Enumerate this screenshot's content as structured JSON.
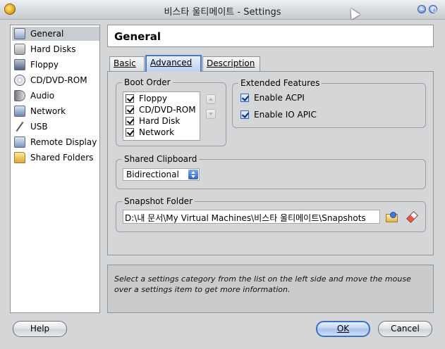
{
  "window": {
    "title": "비스타 울티메이트 - Settings"
  },
  "sidebar": {
    "items": [
      {
        "label": "General",
        "icon": "general-icon",
        "selected": true
      },
      {
        "label": "Hard Disks",
        "icon": "hard-disk-icon"
      },
      {
        "label": "Floppy",
        "icon": "floppy-icon"
      },
      {
        "label": "CD/DVD-ROM",
        "icon": "cd-rom-icon"
      },
      {
        "label": "Audio",
        "icon": "audio-icon"
      },
      {
        "label": "Network",
        "icon": "network-icon"
      },
      {
        "label": "USB",
        "icon": "usb-icon"
      },
      {
        "label": "Remote Display",
        "icon": "remote-display-icon"
      },
      {
        "label": "Shared Folders",
        "icon": "shared-folders-icon"
      }
    ]
  },
  "header": {
    "title": "General"
  },
  "tabs": [
    {
      "label": "Basic",
      "active": false
    },
    {
      "label": "Advanced",
      "active": true
    },
    {
      "label": "Description",
      "active": false
    }
  ],
  "boot_order": {
    "label": "Boot Order",
    "items": [
      {
        "label": "Floppy",
        "checked": true
      },
      {
        "label": "CD/DVD-ROM",
        "checked": true
      },
      {
        "label": "Hard Disk",
        "checked": true
      },
      {
        "label": "Network",
        "checked": true
      }
    ]
  },
  "extended_features": {
    "label": "Extended Features",
    "acpi": {
      "label": "Enable ACPI",
      "checked": true
    },
    "ioapic": {
      "label": "Enable IO APIC",
      "checked": true
    }
  },
  "shared_clipboard": {
    "label": "Shared Clipboard",
    "value": "Bidirectional"
  },
  "snapshot_folder": {
    "label": "Snapshot Folder",
    "path": "D:\\내 문서\\My Virtual Machines\\비스타 울티메이트\\Snapshots"
  },
  "info": {
    "text": "Select a settings category from the list on the left side and move the mouse over a settings item to get more information."
  },
  "buttons": {
    "help": "Help",
    "ok": "OK",
    "cancel": "Cancel"
  },
  "colors": {
    "active_tab_border": "#4a78c4",
    "selection_bg": "#c9ccd0"
  }
}
